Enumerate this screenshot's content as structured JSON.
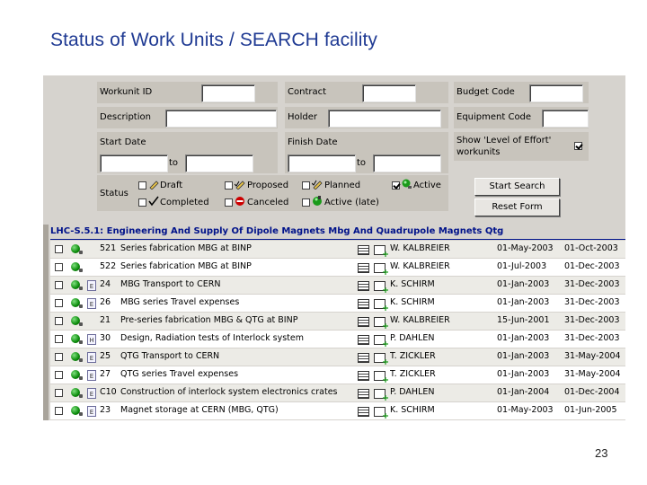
{
  "slide": {
    "title": "Status of Work Units / SEARCH facility",
    "page_number": "23"
  },
  "search_form": {
    "workunit_id_label": "Workunit ID",
    "workunit_id_value": "",
    "contract_label": "Contract",
    "contract_value": "",
    "budget_code_label": "Budget Code",
    "budget_code_value": "",
    "description_label": "Description",
    "description_value": "",
    "holder_label": "Holder",
    "holder_value": "",
    "equipment_code_label": "Equipment Code",
    "equipment_code_value": "",
    "start_date_label": "Start Date",
    "finish_date_label": "Finish Date",
    "to_label": "to",
    "level_of_effort_label": "Show 'Level of Effort' workunits",
    "level_of_effort_checked": true,
    "status_label": "Status",
    "statuses": [
      {
        "label": "Draft",
        "checked": false,
        "icon": "pencil-icon"
      },
      {
        "label": "Proposed",
        "checked": false,
        "icon": "pencil-check-icon"
      },
      {
        "label": "Planned",
        "checked": false,
        "icon": "planned-pencil-icon"
      },
      {
        "label": "Active",
        "checked": true,
        "icon": "green-ball-icon"
      },
      {
        "label": "Completed",
        "checked": false,
        "icon": "checkmark-icon"
      },
      {
        "label": "Canceled",
        "checked": false,
        "icon": "stop-icon"
      },
      {
        "label": "Active (late)",
        "checked": false,
        "icon": "clock-ball-icon"
      }
    ],
    "start_search_label": "Start Search",
    "reset_form_label": "Reset Form"
  },
  "results": {
    "heading": "LHC-S.5.1: Engineering And Supply Of Dipole Magnets Mbg And Quadrupole Magnets Qtg",
    "rows": [
      {
        "doc": "",
        "id": "521",
        "description": "Series fabrication MBG at BINP",
        "holder": "W. KALBREIER",
        "start": "01-May-2003",
        "finish": "01-Oct-2003"
      },
      {
        "doc": "",
        "id": "522",
        "description": "Series fabrication MBG at BINP",
        "holder": "W. KALBREIER",
        "start": "01-Jul-2003",
        "finish": "01-Dec-2003"
      },
      {
        "doc": "E",
        "id": "24",
        "description": "MBG Transport to CERN",
        "holder": "K. SCHIRM",
        "start": "01-Jan-2003",
        "finish": "31-Dec-2003"
      },
      {
        "doc": "E",
        "id": "26",
        "description": "MBG series Travel expenses",
        "holder": "K. SCHIRM",
        "start": "01-Jan-2003",
        "finish": "31-Dec-2003"
      },
      {
        "doc": "",
        "id": "21",
        "description": "Pre-series fabrication MBG & QTG at BINP",
        "holder": "W. KALBREIER",
        "start": "15-Jun-2001",
        "finish": "31-Dec-2003"
      },
      {
        "doc": "H",
        "id": "30",
        "description": "Design, Radiation tests of Interlock system",
        "holder": "P. DAHLEN",
        "start": "01-Jan-2003",
        "finish": "31-Dec-2003"
      },
      {
        "doc": "E",
        "id": "25",
        "description": "QTG Transport to CERN",
        "holder": "T. ZICKLER",
        "start": "01-Jan-2003",
        "finish": "31-May-2004"
      },
      {
        "doc": "E",
        "id": "27",
        "description": "QTG series Travel expenses",
        "holder": "T. ZICKLER",
        "start": "01-Jan-2003",
        "finish": "31-May-2004"
      },
      {
        "doc": "E",
        "id": "C10",
        "description": "Construction of interlock system electronics crates",
        "holder": "P. DAHLEN",
        "start": "01-Jan-2004",
        "finish": "01-Dec-2004"
      },
      {
        "doc": "E",
        "id": "23",
        "description": "Magnet storage at CERN (MBG, QTG)",
        "holder": "K. SCHIRM",
        "start": "01-May-2003",
        "finish": "01-Jun-2005"
      }
    ]
  }
}
